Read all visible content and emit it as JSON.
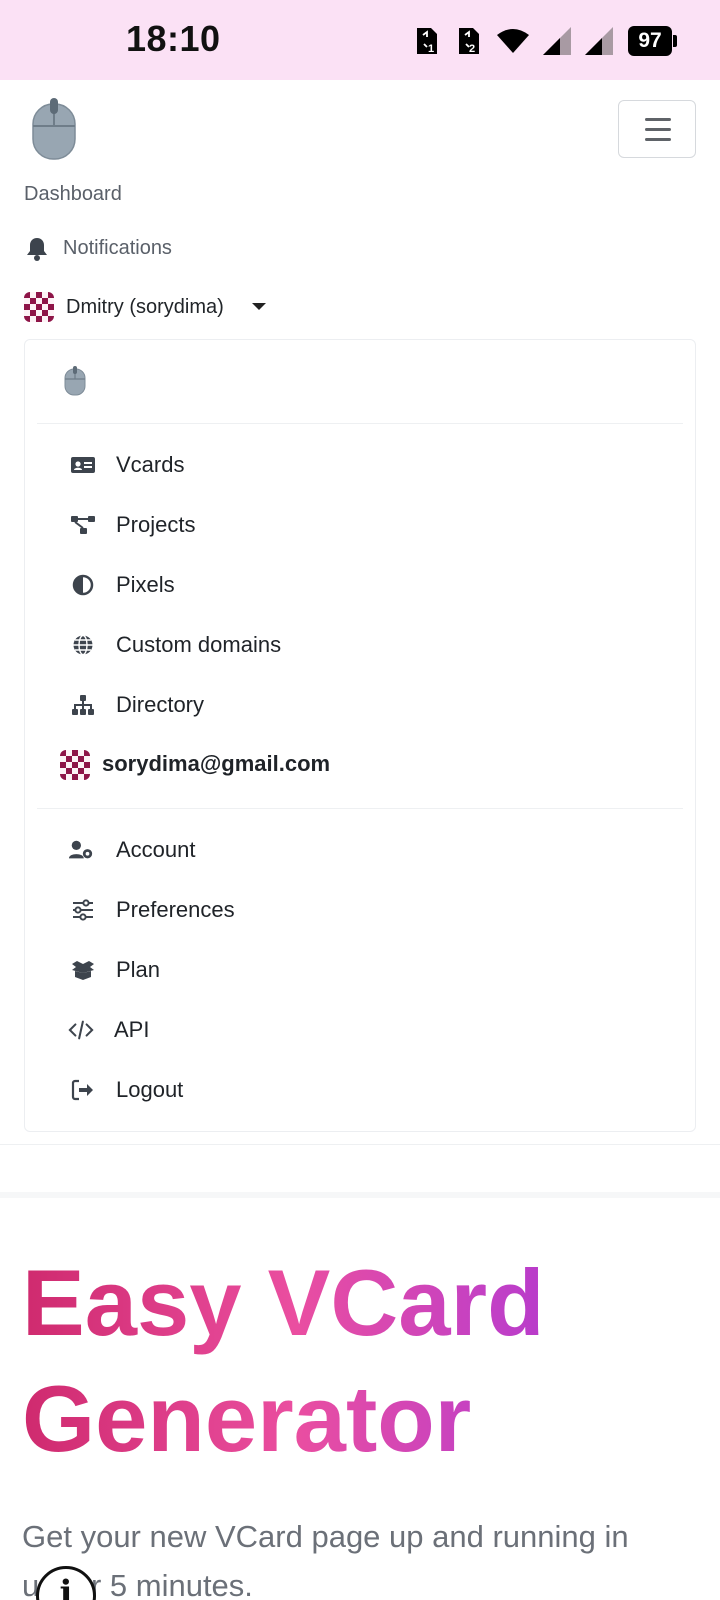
{
  "status_bar": {
    "time": "18:10",
    "battery": "97",
    "sim1": "1",
    "sim2": "2",
    "icons": [
      "sim-1-icon",
      "sim-2-icon",
      "wifi-icon",
      "signal-1-icon",
      "signal-2-icon",
      "battery-icon"
    ]
  },
  "navbar": {
    "logo_icon": "mouse-logo-icon",
    "toggler_icon": "hamburger-menu-icon",
    "dashboard_label": "Dashboard",
    "notifications_label": "Notifications",
    "notifications_icon": "bell-icon",
    "user_label": "Dmitry (sorydima)",
    "user_caret_icon": "caret-down-icon"
  },
  "dropdown": {
    "logo_icon": "mouse-logo-icon",
    "items": [
      {
        "label": "Vcards",
        "icon": "id-card-icon"
      },
      {
        "label": "Projects",
        "icon": "project-diagram-icon"
      },
      {
        "label": "Pixels",
        "icon": "half-circle-icon"
      },
      {
        "label": "Custom domains",
        "icon": "globe-icon"
      },
      {
        "label": "Directory",
        "icon": "sitemap-icon"
      }
    ],
    "email": "sorydima@gmail.com",
    "account_items": [
      {
        "label": "Account",
        "icon": "user-cog-icon"
      },
      {
        "label": "Preferences",
        "icon": "sliders-icon"
      },
      {
        "label": "Plan",
        "icon": "box-open-icon"
      },
      {
        "label": "API",
        "icon": "code-icon"
      },
      {
        "label": "Logout",
        "icon": "sign-out-icon"
      }
    ]
  },
  "hero": {
    "title_line1": "Easy VCard",
    "title_line2": "Generator",
    "subtitle": "Get your new VCard page up and running in under 5 minutes.",
    "info_icon": "info-icon"
  },
  "colors": {
    "status_bar_bg": "#fbe1f5",
    "gradient": [
      "#cf2a6e",
      "#ea4ea0",
      "#c140c6",
      "#9a2ad8"
    ],
    "avatar": "#8e1548"
  }
}
